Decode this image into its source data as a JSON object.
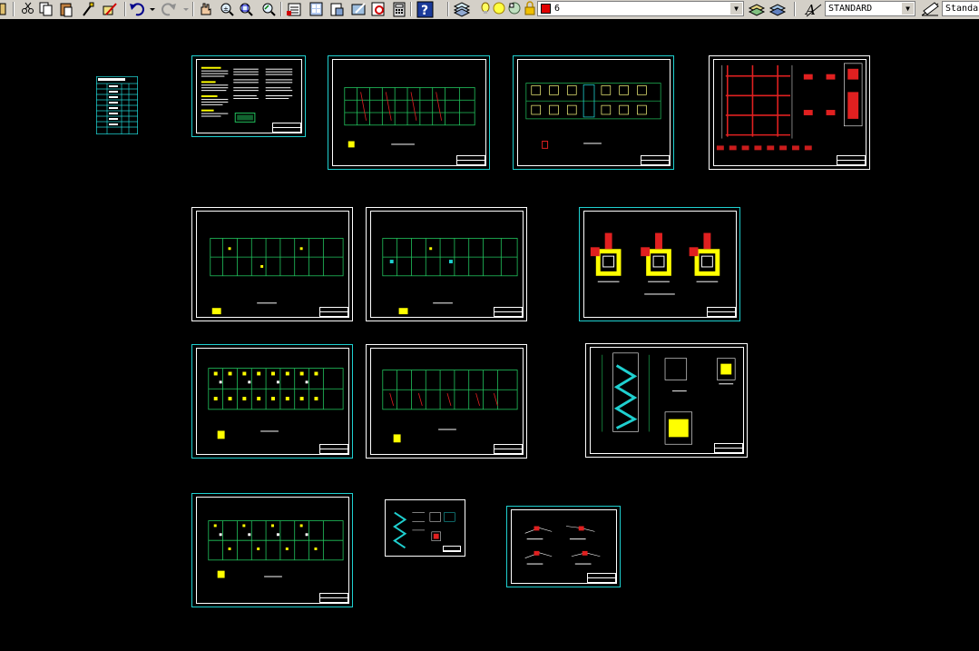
{
  "toolbar": {
    "layer_combo": {
      "value": "6",
      "color": "#e00000"
    },
    "text_style_combo": {
      "value": "STANDARD"
    },
    "dim_style_combo": {
      "value": "Standa"
    },
    "icons": [
      "cut-icon",
      "copy-icon",
      "paste-icon",
      "match-properties-icon",
      "block-editor-icon",
      "undo-icon",
      "redo-icon",
      "pan-icon",
      "zoom-realtime-icon",
      "zoom-window-icon",
      "zoom-previous-icon",
      "properties-icon",
      "design-center-icon",
      "tool-palettes-icon",
      "markup-icon",
      "calculator-icon",
      "help-icon",
      "layer-manager-icon",
      "layer-state-icons",
      "layer-previous-icon",
      "text-style-icon",
      "dim-style-icon"
    ]
  },
  "colors": {
    "background": "#000000",
    "sheet_border_cyan": "#1fd0d0",
    "grid_green": "#22c55e",
    "accent_yellow": "#ffff00",
    "rebar_red": "#e02020",
    "cad_white": "#ffffff"
  },
  "drawing": {
    "sheets": [
      {
        "id": "legend-table",
        "kind": "table"
      },
      {
        "id": "general-notes",
        "kind": "notes"
      },
      {
        "id": "foundation-plan-1",
        "kind": "plan"
      },
      {
        "id": "foundation-plan-2",
        "kind": "footing-plan"
      },
      {
        "id": "frame-elevation",
        "kind": "elevation"
      },
      {
        "id": "floor-plan-1",
        "kind": "plan"
      },
      {
        "id": "floor-plan-2",
        "kind": "plan"
      },
      {
        "id": "column-footing-details",
        "kind": "details"
      },
      {
        "id": "floor-plan-3",
        "kind": "plan-busy"
      },
      {
        "id": "floor-plan-4",
        "kind": "plan"
      },
      {
        "id": "stair-details",
        "kind": "stair"
      },
      {
        "id": "floor-plan-5",
        "kind": "plan-busy"
      },
      {
        "id": "small-stair-detail",
        "kind": "stair-small"
      },
      {
        "id": "section-details",
        "kind": "sections"
      }
    ]
  }
}
